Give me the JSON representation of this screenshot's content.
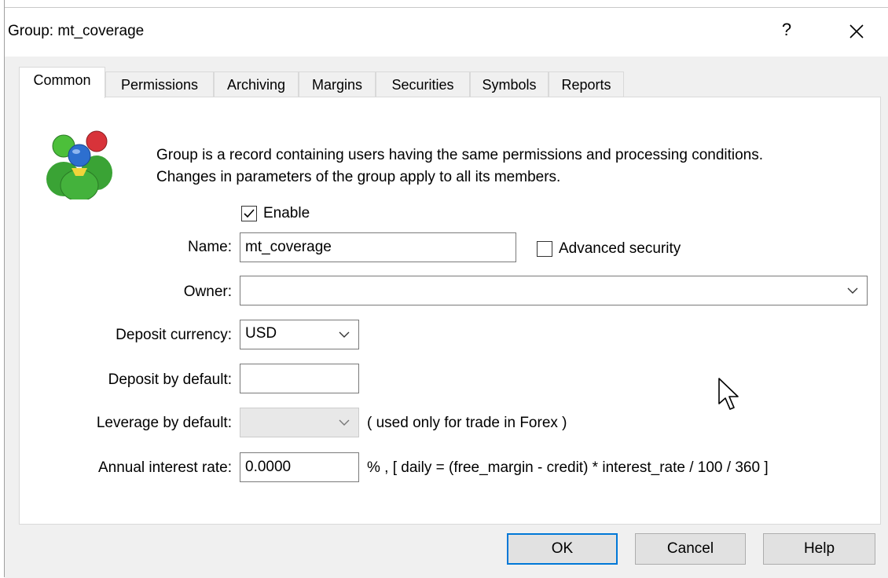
{
  "window": {
    "title": "Group: mt_coverage",
    "help_glyph": "?",
    "close_icon": "close-icon"
  },
  "tabs": [
    {
      "label": "Common",
      "active": true
    },
    {
      "label": "Permissions",
      "active": false
    },
    {
      "label": "Archiving",
      "active": false
    },
    {
      "label": "Margins",
      "active": false
    },
    {
      "label": "Securities",
      "active": false
    },
    {
      "label": "Symbols",
      "active": false
    },
    {
      "label": "Reports",
      "active": false
    }
  ],
  "description": {
    "line1": "Group is a record containing users having the same permissions and processing conditions.",
    "line2": "Changes in parameters of the group apply to all its members."
  },
  "form": {
    "enable": {
      "label": "Enable",
      "checked": true
    },
    "name": {
      "label": "Name:",
      "value": "mt_coverage"
    },
    "advanced_security": {
      "label": "Advanced security",
      "checked": false
    },
    "owner": {
      "label": "Owner:",
      "value": ""
    },
    "deposit_currency": {
      "label": "Deposit currency:",
      "value": "USD"
    },
    "deposit_default": {
      "label": "Deposit by default:",
      "value": ""
    },
    "leverage_default": {
      "label": "Leverage by default:",
      "value": "",
      "disabled": true,
      "note": "( used only for trade in Forex )"
    },
    "annual_interest": {
      "label": "Annual interest rate:",
      "value": "0.0000",
      "note": "% , [ daily = (free_margin - credit) * interest_rate / 100 / 360 ]"
    }
  },
  "buttons": {
    "ok": "OK",
    "cancel": "Cancel",
    "help": "Help"
  },
  "colors": {
    "dialog_bg": "#f0f0f0",
    "panel_bg": "#ffffff",
    "default_button_border": "#0078d7"
  }
}
